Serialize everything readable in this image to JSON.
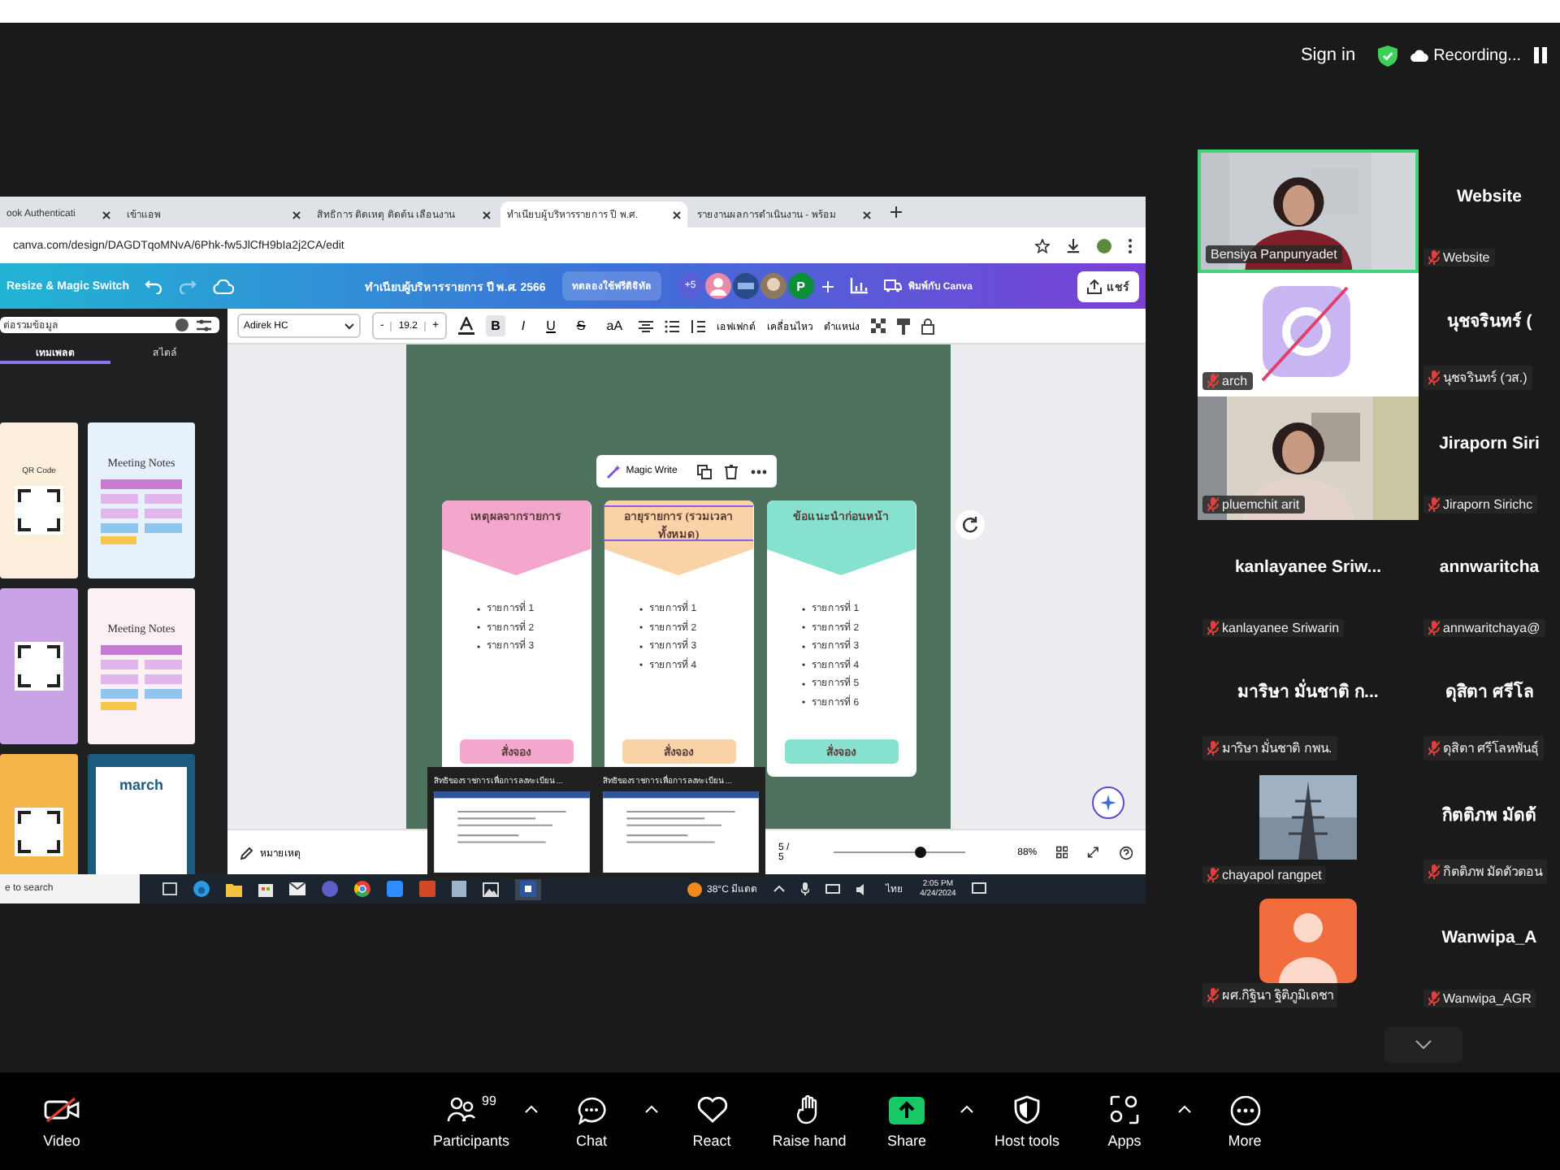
{
  "top_bar": {
    "sign_in": "Sign in",
    "recording": "Recording..."
  },
  "browser": {
    "tabs": [
      {
        "title": "ook Authenticati",
        "selected": false
      },
      {
        "title": "เข้าแอพ",
        "selected": false
      },
      {
        "title": "สิทธิการ ติดเหตุ ติดต้น เลือนงาน",
        "selected": false
      },
      {
        "title": "ทำเนียบผู้บริหารรายการ ปี พ.ศ.",
        "selected": true
      },
      {
        "title": "รายงานผลการดำเนินงาน - พร้อม",
        "selected": false
      }
    ],
    "url": "canva.com/design/DAGDTqoMNvA/6Phk-fw5JlCfH9bIa2j2CA/edit"
  },
  "canva": {
    "header": {
      "resize_button": "Resize & Magic Switch",
      "title": "ทำเนียบผู้บริหารรายการ ปี พ.ศ. 2566",
      "trial_button": "ทดลองใช้ฟรีดิจิทัล",
      "collaborator_count": "+5",
      "avatar_letter": "P",
      "print_button": "พิมพ์กับ Canva",
      "share_button": "แชร์"
    },
    "sidebar": {
      "search_value": "ต่อรวมข้อมูล",
      "tabs": [
        {
          "label": "เทมเพลต",
          "selected": true
        },
        {
          "label": "สไตล์",
          "selected": false
        }
      ],
      "templates": [
        {
          "kind": "qr",
          "text": "QR Code",
          "color": "#fbefdc"
        },
        {
          "kind": "notes",
          "text": "Meeting Notes",
          "color": "#e6f1fb"
        },
        {
          "kind": "qr",
          "color": "#c9a3e6"
        },
        {
          "kind": "notes",
          "text": "Meeting Notes",
          "color": "#fbf1f4"
        },
        {
          "kind": "qr",
          "color": "#f5b54a"
        },
        {
          "kind": "calendar",
          "text": "march",
          "color": "#1e5a80"
        }
      ]
    },
    "toolbar": {
      "font": "Adirek HC",
      "minus": "-",
      "size": "19.2",
      "plus": "+",
      "format_buttons": [
        {
          "label": "B",
          "selected": true
        },
        {
          "label": "I",
          "selected": false
        },
        {
          "label": "U",
          "selected": false
        },
        {
          "label": "S",
          "selected": false
        },
        {
          "label": "aA",
          "selected": false
        }
      ],
      "text_buttons": [
        "เอฟเฟกต์",
        "เคลื่อนไหว",
        "ตำแหน่ง"
      ]
    },
    "canvas": {
      "magic_write": "Magic Write",
      "bullet": "•",
      "cards": [
        {
          "title": "เหตุผลจากรายการ",
          "color": "#f4a7cc",
          "selected": false,
          "items": [
            "รายการที่ 1",
            "รายการที่ 2",
            "รายการที่ 3"
          ],
          "button": "สั่งจอง"
        },
        {
          "title": "อายุรายการ (รวมเวลาทั้งหมด)",
          "color": "#f9d3a6",
          "selected": true,
          "items": [
            "รายการที่ 1",
            "รายการที่ 2",
            "รายการที่ 3",
            "รายการที่ 4"
          ],
          "button": "สั่งจอง"
        },
        {
          "title": "ข้อแนะนำก่อนหน้า",
          "color": "#86e2cf",
          "selected": false,
          "items": [
            "รายการที่ 1",
            "รายการที่ 2",
            "รายการที่ 3",
            "รายการที่ 4",
            "รายการที่ 5",
            "รายการที่ 6"
          ],
          "button": "สั่งจอง"
        }
      ]
    },
    "footer": {
      "notes": "หมายเหตุ",
      "page": "5 / 5",
      "zoom": "88%",
      "level": 0.65
    }
  },
  "taskbar": {
    "search": "e to search",
    "weather": "38°C มีแดด",
    "language": "ไทย",
    "time": "2:05 PM",
    "date": "4/24/2024",
    "previews": [
      {
        "title": "สิทธิของราชการเพื่อการลงทะเบียน ..."
      },
      {
        "title": "สิทธิของราชการเพื่อการลงทะเบียน ..."
      }
    ]
  },
  "participants": [
    {
      "kind": "video",
      "label": "Bensiya Panpunyadet",
      "speaking": true,
      "muted": false
    },
    {
      "kind": "name",
      "name": "Website",
      "label": "Website",
      "speaking": false,
      "muted": true
    },
    {
      "kind": "logo",
      "label": "arch",
      "speaking": false,
      "muted": true
    },
    {
      "kind": "name",
      "name": "นุชจรินทร์ (",
      "label": "นุชจรินทร์ (วส.)",
      "speaking": false,
      "muted": true
    },
    {
      "kind": "video",
      "label": "pluemchit arit",
      "speaking": false,
      "muted": true
    },
    {
      "kind": "name",
      "name": "Jiraporn  Siri",
      "label": "Jiraporn Sirichc",
      "speaking": false,
      "muted": true
    },
    {
      "kind": "name",
      "name": "kanlayanee  Sriw...",
      "label": "kanlayanee Sriwarin",
      "speaking": false,
      "muted": true
    },
    {
      "kind": "name",
      "name": "annwaritcha",
      "label": "annwaritchaya@",
      "speaking": false,
      "muted": true
    },
    {
      "kind": "name",
      "name": "มาริษา มั่นชาติ ก...",
      "label": "มาริษา มั่นชาติ กพน.",
      "speaking": false,
      "muted": true
    },
    {
      "kind": "name",
      "name": "ดุสิตา  ศรีโล",
      "label": "ดุสิตา ศรีโลหพันธุ์",
      "speaking": false,
      "muted": true
    },
    {
      "label": "chayapol rangpet",
      "speaking": false,
      "muted": true
    },
    {
      "kind": "name",
      "name": "กิตติภพ มัดต้",
      "label": "กิตติภพ มัดตัวตอน",
      "speaking": false,
      "muted": true
    },
    {
      "kind": "avatar",
      "label": "ผศ.กิฐินา ฐิติภูมิเดชา",
      "speaking": false,
      "muted": true
    },
    {
      "kind": "name",
      "name": "Wanwipa_A",
      "label": "Wanwipa_AGR",
      "speaking": false,
      "muted": true
    }
  ],
  "controls": [
    {
      "kind": "video",
      "label": "Video",
      "off": true
    },
    {
      "kind": "participants",
      "label": "Participants",
      "count": "99",
      "caret": true
    },
    {
      "kind": "chat",
      "label": "Chat",
      "caret": true
    },
    {
      "kind": "react",
      "label": "React",
      "caret": false
    },
    {
      "kind": "hand",
      "label": "Raise hand",
      "caret": false
    },
    {
      "kind": "share",
      "label": "Share",
      "caret": true
    },
    {
      "kind": "host",
      "label": "Host tools",
      "caret": false
    },
    {
      "kind": "apps",
      "label": "Apps",
      "caret": true
    },
    {
      "kind": "more",
      "label": "More",
      "caret": false
    }
  ]
}
